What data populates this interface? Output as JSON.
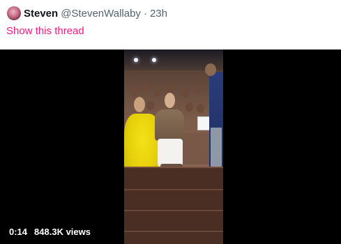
{
  "tweet": {
    "author_name": "Steven",
    "author_handle": "@StevenWallaby",
    "separator": "·",
    "time": "23h",
    "thread_link": "Show this thread"
  },
  "video": {
    "duration": "0:14",
    "views": "848.3K views"
  },
  "colors": {
    "accent": "#f91880",
    "media_background": "#000000",
    "secondary_text": "#536471"
  }
}
